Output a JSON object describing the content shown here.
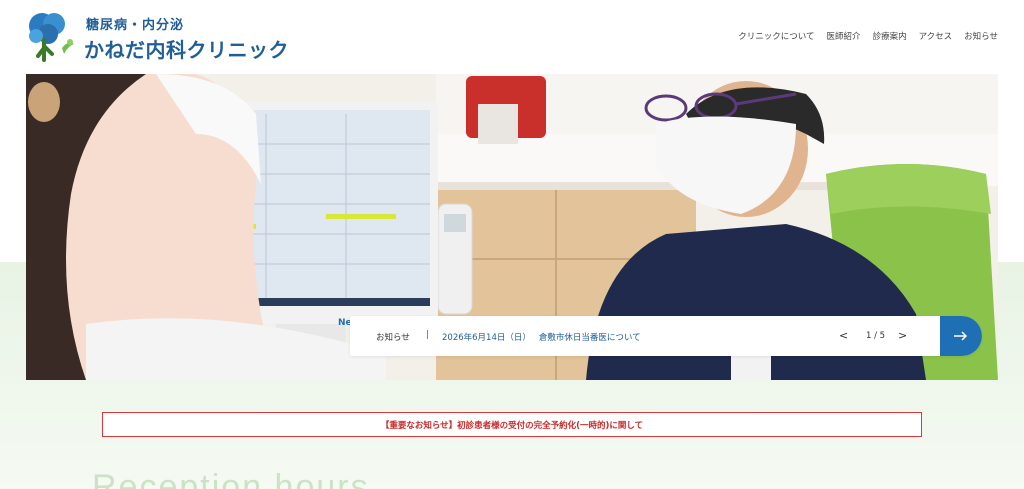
{
  "header": {
    "logo_subtitle": "糖尿病・内分泌",
    "logo_title": "かねだ内科クリニック",
    "nav": [
      {
        "label": "クリニックについて"
      },
      {
        "label": "医師紹介"
      },
      {
        "label": "診療案内"
      },
      {
        "label": "アクセス"
      },
      {
        "label": "お知らせ"
      }
    ]
  },
  "news": {
    "tag": "News",
    "label": "お知らせ",
    "separator": "|",
    "date": "2026年6月14日（日）",
    "headline": "倉敷市休日当番医について",
    "prev": "<",
    "page": "1 / 5",
    "next": ">"
  },
  "notice": {
    "text": "【重要なお知らせ】初診患者様の受付の完全予約化(一時的)に関して"
  },
  "section": {
    "heading": "Reception hours"
  },
  "colors": {
    "brand_blue": "#1f5e97",
    "accent_blue": "#1f6fb4",
    "notice_red": "#c92a2a",
    "bg_green": "#e8f3e4"
  },
  "icons": {
    "logo": "tree-logo-icon",
    "news_go": "arrow-right-icon"
  }
}
